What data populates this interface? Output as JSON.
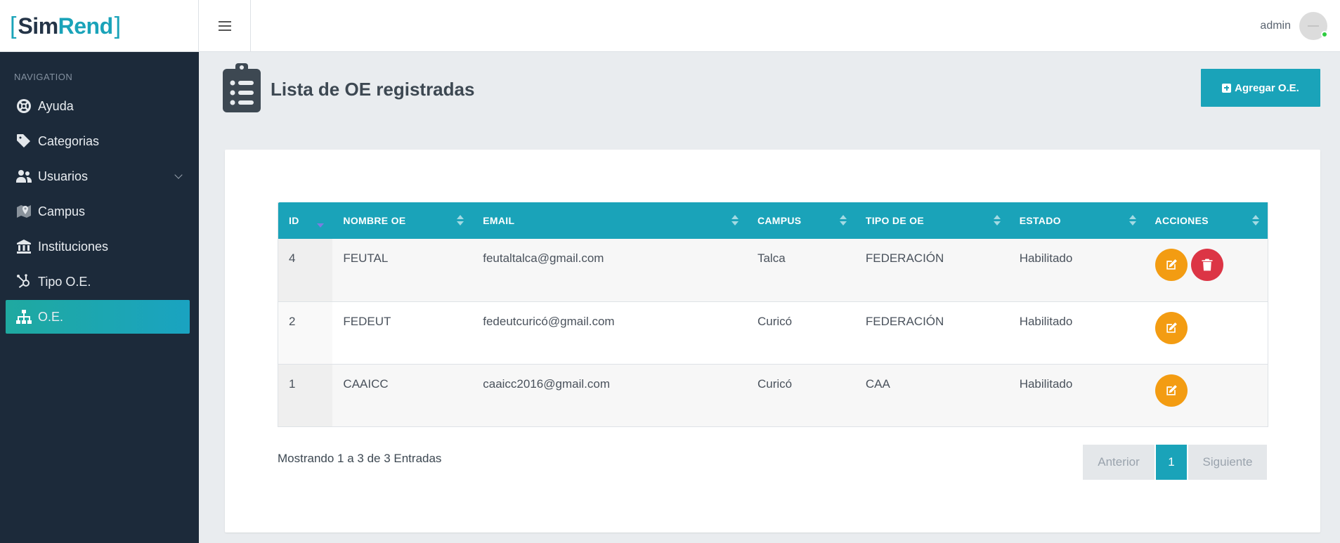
{
  "brand": {
    "bracket_open": "[",
    "part1": "Sim",
    "part2": "Rend",
    "bracket_close": "]"
  },
  "header": {
    "username": "admin"
  },
  "sidebar": {
    "title": "NAVIGATION",
    "items": [
      {
        "label": "Ayuda",
        "icon": "life-ring-icon"
      },
      {
        "label": "Categorias",
        "icon": "tag-icon"
      },
      {
        "label": "Usuarios",
        "icon": "users-icon",
        "has_submenu": true
      },
      {
        "label": "Campus",
        "icon": "map-marker-icon"
      },
      {
        "label": "Instituciones",
        "icon": "bank-icon"
      },
      {
        "label": "Tipo O.E.",
        "icon": "hubspot-icon"
      },
      {
        "label": "O.E.",
        "icon": "sitemap-icon",
        "active": true
      }
    ]
  },
  "page": {
    "title": "Lista de OE registradas",
    "add_button": "Agregar O.E."
  },
  "table": {
    "columns": [
      "ID",
      "NOMBRE OE",
      "EMAIL",
      "CAMPUS",
      "TIPO DE OE",
      "ESTADO",
      "ACCIONES"
    ],
    "rows": [
      {
        "id": "4",
        "nombre": "FEUTAL",
        "email": "feutaltalca@gmail.com",
        "campus": "Talca",
        "tipo": "FEDERACIÓN",
        "estado": "Habilitado",
        "actions": [
          "edit",
          "delete"
        ]
      },
      {
        "id": "2",
        "nombre": "FEDEUT",
        "email": "fedeutcuricó@gmail.com",
        "campus": "Curicó",
        "tipo": "FEDERACIÓN",
        "estado": "Habilitado",
        "actions": [
          "edit"
        ]
      },
      {
        "id": "1",
        "nombre": "CAAICC",
        "email": "caaicc2016@gmail.com",
        "campus": "Curicó",
        "tipo": "CAA",
        "estado": "Habilitado",
        "actions": [
          "edit"
        ]
      }
    ]
  },
  "footer": {
    "info": "Mostrando 1 a 3 de 3 Entradas",
    "prev": "Anterior",
    "page": "1",
    "next": "Siguiente"
  },
  "colors": {
    "accent": "#1aa3b9",
    "sidebar": "#1c2a3a",
    "edit": "#f39c12",
    "delete": "#dc3545"
  }
}
